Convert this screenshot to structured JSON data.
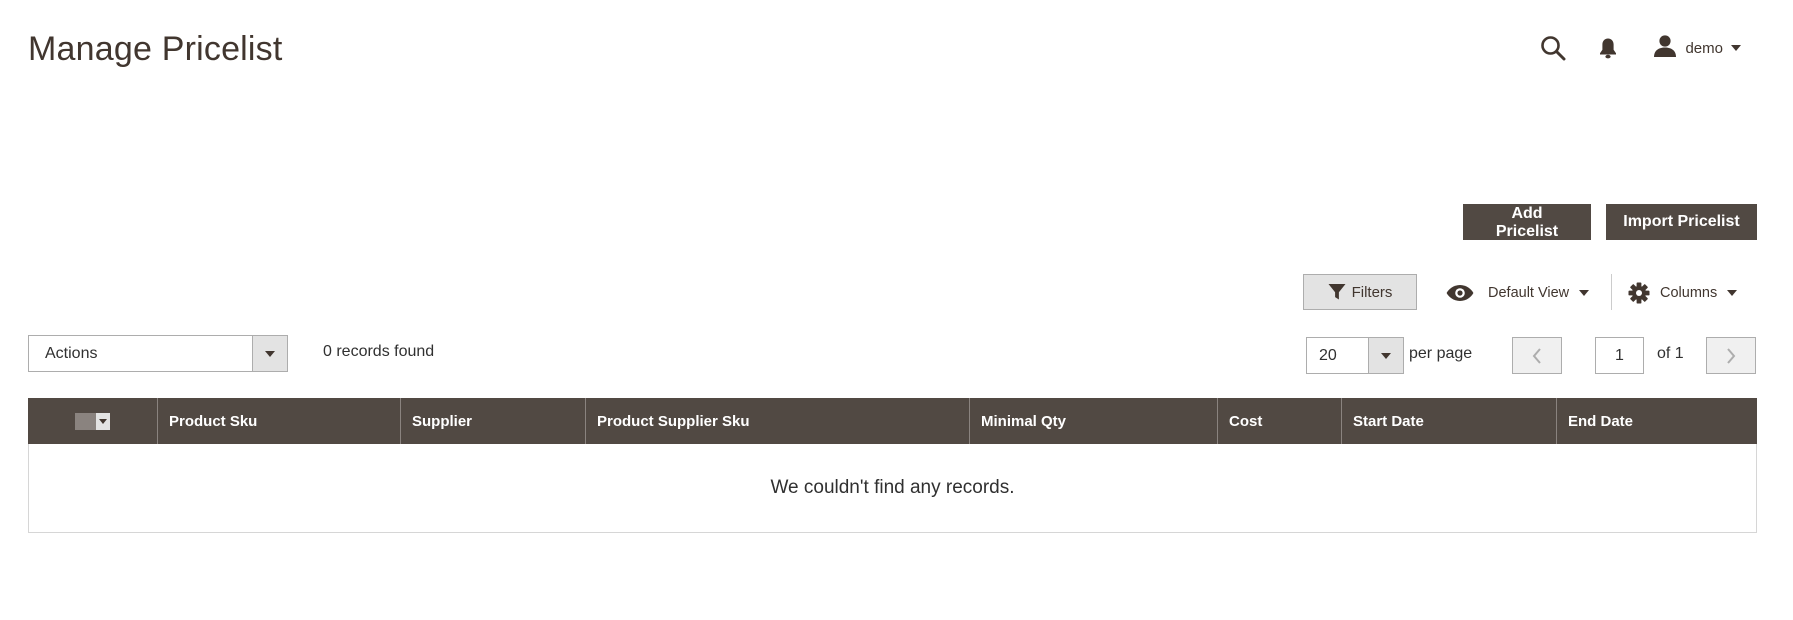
{
  "page": {
    "title": "Manage Pricelist"
  },
  "header": {
    "search_icon": "search-icon",
    "notifications_icon": "bell-icon",
    "user_icon": "user-icon",
    "user_name": "demo"
  },
  "toolbar": {
    "add_label": "Add Pricelist",
    "import_label": "Import Pricelist"
  },
  "grid_controls": {
    "filters_label": "Filters",
    "view_label": "Default View",
    "columns_label": "Columns",
    "actions_label": "Actions",
    "records_found": "0 records found",
    "per_page_value": "20",
    "per_page_label": "per page",
    "current_page": "1",
    "page_of": "of 1"
  },
  "grid": {
    "columns": [
      "Product Sku",
      "Supplier",
      "Product Supplier Sku",
      "Minimal Qty",
      "Cost",
      "Start Date",
      "End Date"
    ],
    "empty_message": "We couldn't find any records."
  },
  "colors": {
    "header_bg": "#514943",
    "button_bg": "#514943",
    "title_color": "#41362f"
  }
}
